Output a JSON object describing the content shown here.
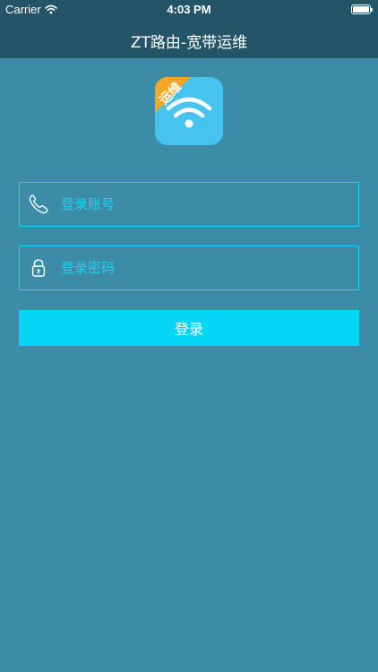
{
  "status_bar": {
    "carrier": "Carrier",
    "time": "4:03 PM",
    "battery_level": 1.0
  },
  "nav": {
    "title": "ZT路由-宽带运维"
  },
  "app_icon": {
    "ribbon_text": "运维",
    "background_color": "#46c3ee",
    "ribbon_color": "#f5a623",
    "icon": "wifi-icon"
  },
  "form": {
    "account": {
      "placeholder": "登录账号",
      "value": "",
      "icon": "phone-icon"
    },
    "password": {
      "placeholder": "登录密码",
      "value": "",
      "icon": "lock-icon"
    },
    "login_label": "登录"
  },
  "colors": {
    "background": "#3c8ca8",
    "header": "#245468",
    "accent": "#06d5f5",
    "field_border": "#19d2f0"
  }
}
